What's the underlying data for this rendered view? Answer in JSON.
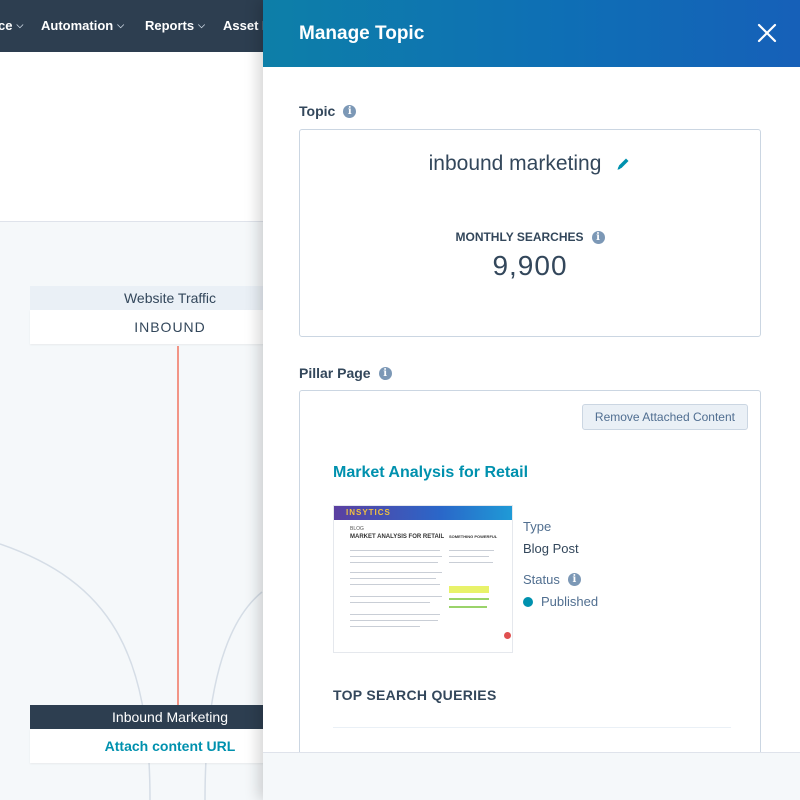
{
  "nav": {
    "items": [
      {
        "label": "ce"
      },
      {
        "label": "Automation"
      },
      {
        "label": "Reports"
      },
      {
        "label": "Asset I"
      }
    ]
  },
  "canvas": {
    "cards": {
      "traffic": {
        "heading": "Website Traffic",
        "value": "INBOUND"
      },
      "inbound": {
        "heading": "Inbound Marketing",
        "link": "Attach content URL"
      }
    },
    "colors": {
      "line": "#f2745f",
      "curve": "#cbd6e2"
    }
  },
  "panel": {
    "title": "Manage Topic",
    "close_icon": "close-icon",
    "topic": {
      "label": "Topic",
      "name": "inbound marketing",
      "monthly_searches_label": "MONTHLY SEARCHES",
      "monthly_searches_value": "9,900"
    },
    "pillar": {
      "label": "Pillar Page",
      "remove_button": "Remove Attached Content",
      "page_title": "Market Analysis for Retail",
      "thumbnail": {
        "brand": "INSYTICS",
        "kicker": "BLOG",
        "headline": "MARKET ANALYSIS FOR RETAIL",
        "side_heading": "SOMETHING POWERFUL"
      },
      "type_label": "Type",
      "type_value": "Blog Post",
      "status_label": "Status",
      "status_value": "Published",
      "status_color": "#0091ae",
      "top_search_queries_label": "TOP SEARCH QUERIES"
    }
  }
}
